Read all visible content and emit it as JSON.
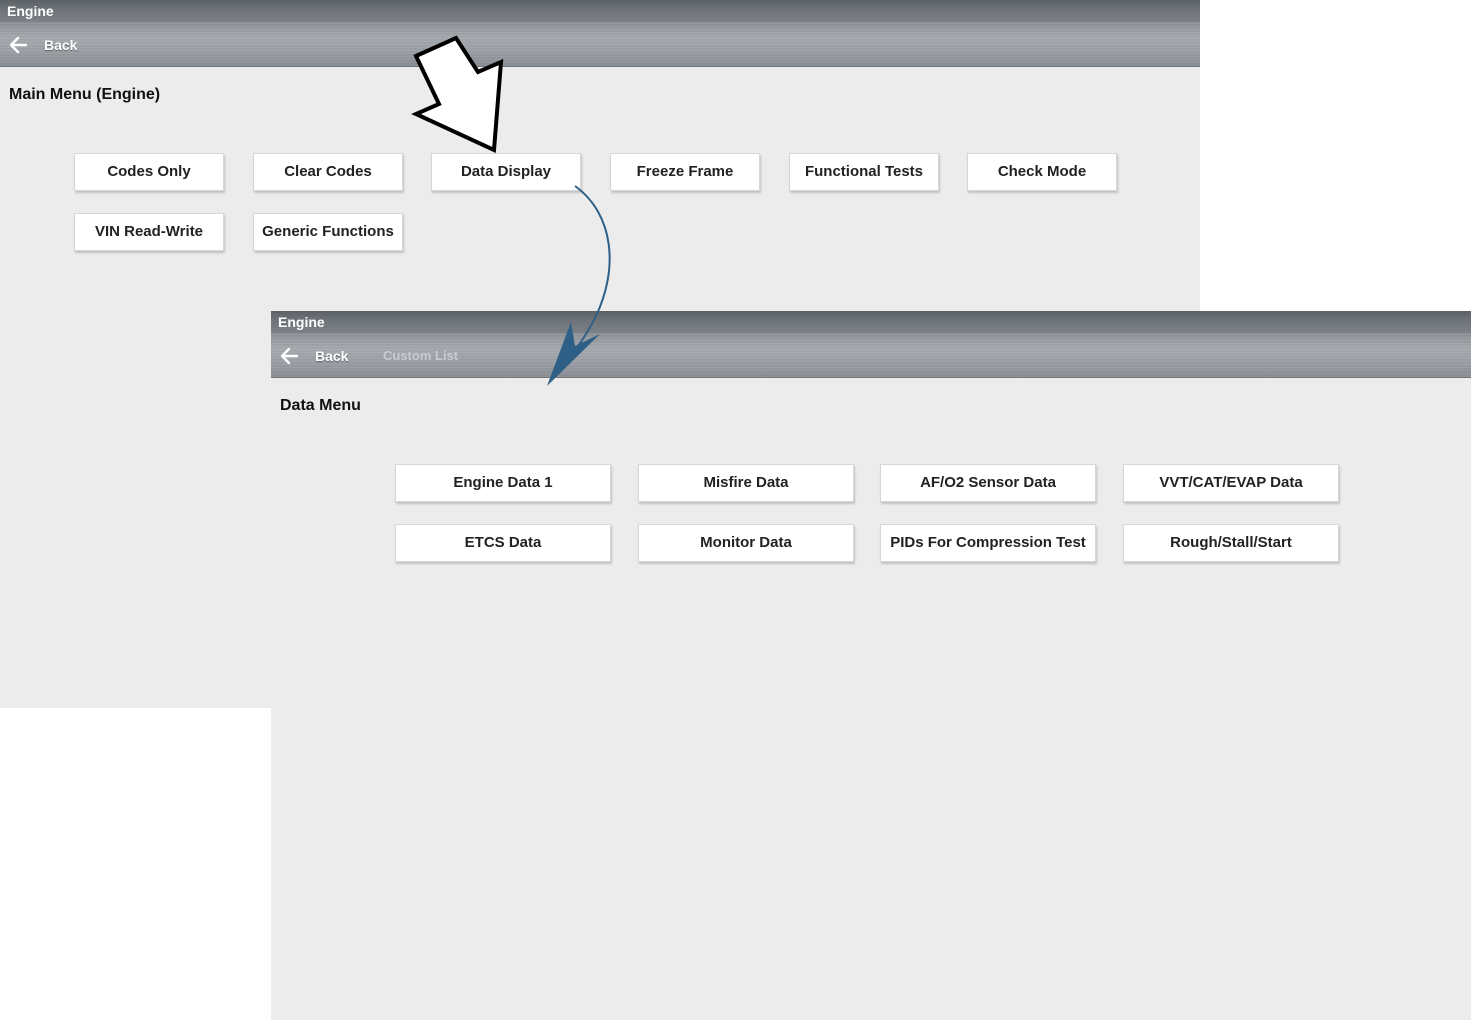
{
  "screen1": {
    "title": "Engine",
    "back_label": "Back",
    "heading": "Main Menu (Engine)",
    "buttons": [
      "Codes Only",
      "Clear Codes",
      "Data Display",
      "Freeze Frame",
      "Functional Tests",
      "Check Mode",
      "VIN Read-Write",
      "Generic Functions"
    ]
  },
  "screen2": {
    "title": "Engine",
    "back_label": "Back",
    "custom_list_label": "Custom List",
    "heading": "Data Menu",
    "buttons": [
      "Engine Data 1",
      "Misfire Data",
      "AF/O2 Sensor Data",
      "VVT/CAT/EVAP Data",
      "ETCS Data",
      "Monitor Data",
      "PIDs For Compression Test",
      "Rough/Stall/Start"
    ]
  },
  "colors": {
    "background": "#ececec",
    "titlebar": "#6d7278",
    "flow_arrow": "#2e5f86"
  },
  "icons": {
    "back": "arrow-left-icon",
    "pointer": "outline-arrow-icon",
    "flow": "curved-arrow-icon"
  }
}
